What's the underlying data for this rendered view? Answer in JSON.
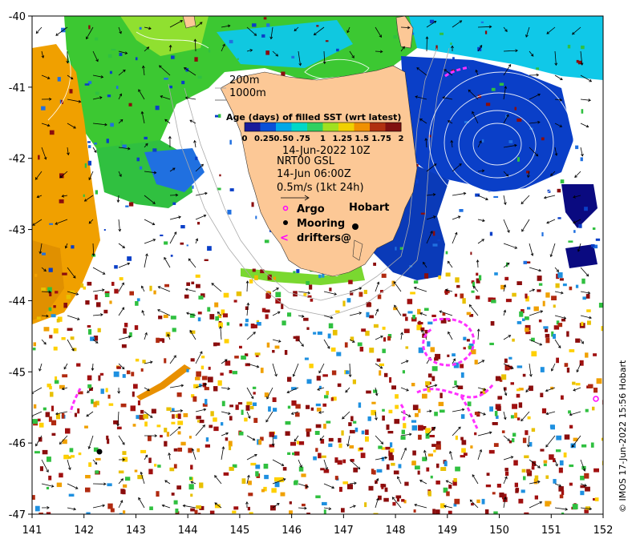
{
  "map": {
    "x_ticks": [
      "141",
      "142",
      "143",
      "144",
      "145",
      "146",
      "147",
      "148",
      "149",
      "150",
      "151",
      "152"
    ],
    "y_ticks": [
      "-40",
      "-41",
      "-42",
      "-43",
      "-44",
      "-45",
      "-46",
      "-47"
    ],
    "lon_range": [
      141,
      152
    ],
    "lat_range": [
      -47,
      -40
    ]
  },
  "legend": {
    "isobaths": [
      "200m",
      "1000m"
    ],
    "colorbar_title": "Age (days) of filled SST (wrt latest)",
    "colorbar_ticks": [
      "0",
      "0.25",
      "0.50",
      ".75",
      "1",
      "1.25",
      "1.5",
      "1.75",
      "2"
    ],
    "colorbar_colors": [
      "#1a1a9a",
      "#0a50d8",
      "#00a8e8",
      "#00d8c8",
      "#30d060",
      "#a0e020",
      "#f0d000",
      "#f09000",
      "#b03010",
      "#801010"
    ],
    "sst_date": "14-Jun-2022 10Z",
    "current_source": "NRT00 GSL",
    "current_date": "14-Jun 06:00Z",
    "arrow_scale": "0.5m/s (1kt 24h)",
    "argo_label": "Argo",
    "mooring_label": "Mooring",
    "drifters_label": "drifters@"
  },
  "places": {
    "hobart": "Hobart"
  },
  "credit": "© IMOS 17-Jun-2022 15:56 Hobart",
  "colors": {
    "land": "#fcc896",
    "argo": "#ff00ff",
    "drifter": "#ff30ff",
    "isobath": "#aaaaaa",
    "arrow": "#000000"
  }
}
